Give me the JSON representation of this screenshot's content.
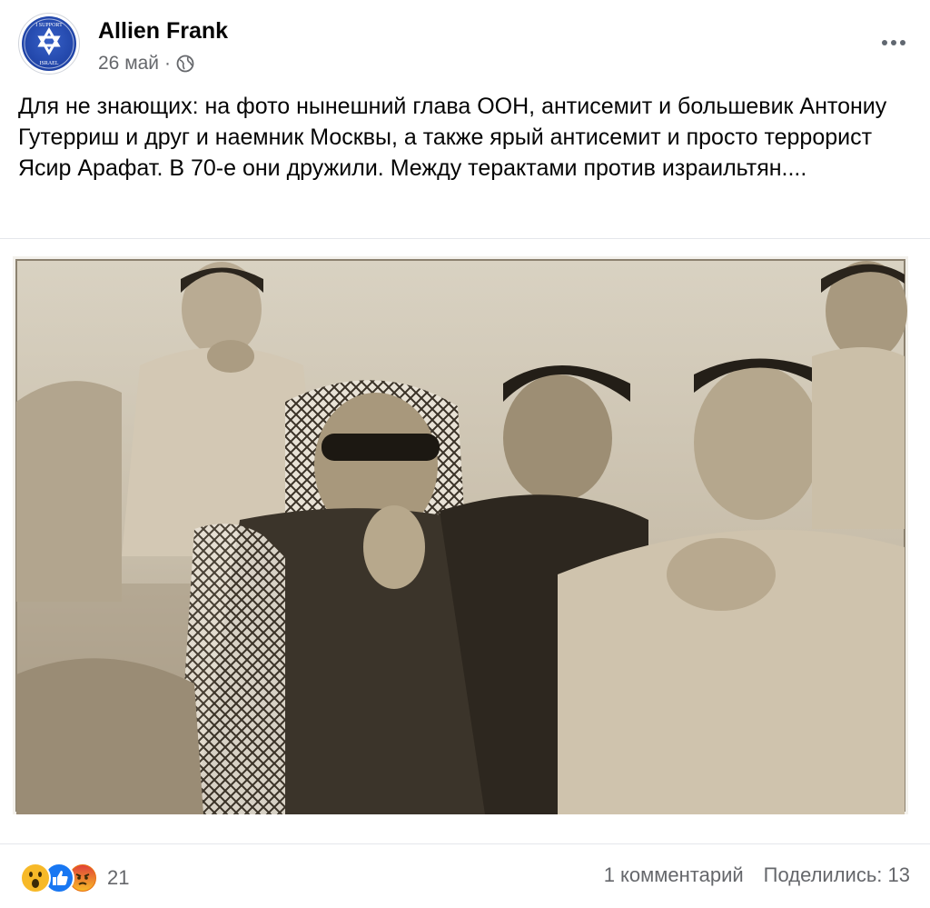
{
  "post": {
    "author": "Allien Frank",
    "date": "26 май",
    "separator": "·",
    "privacy_icon": "globe-icon",
    "avatar_text_top": "I SUPPORT",
    "avatar_text_bottom": "ISRAEL",
    "text": "Для не знающих: на фото нынешний глава ООН, антисемит и большевик Антониу Гутерриш и друг и наемник Москвы, а также ярый антисемит и просто террорист Ясир Арафат. В 70-е они дружили. Между терактами против израильтян...."
  },
  "reactions": {
    "icons": [
      "wow-reaction-icon",
      "like-reaction-icon",
      "angry-reaction-icon"
    ],
    "count": "21"
  },
  "stats": {
    "comments": "1 комментарий",
    "shares": "Поделились: 13"
  },
  "colors": {
    "like": "#1877f2",
    "wow": "#f7b928",
    "angry": "#e9710f",
    "secondary_text": "#65676b"
  }
}
